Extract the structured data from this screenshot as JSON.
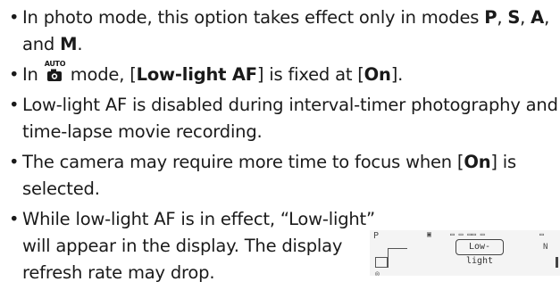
{
  "notes": [
    {
      "segments": [
        {
          "t": "In photo mode, this option takes effect only in modes "
        },
        {
          "t": "P",
          "b": true
        },
        {
          "t": ", "
        },
        {
          "t": "S",
          "b": true
        },
        {
          "t": ", "
        },
        {
          "t": "A",
          "b": true
        },
        {
          "t": ", and "
        },
        {
          "t": "M",
          "b": true
        },
        {
          "t": "."
        }
      ]
    },
    {
      "segments": [
        {
          "t": "In "
        },
        {
          "icon": "auto-mode-camera-icon",
          "label": "AUTO"
        },
        {
          "t": " mode, ["
        },
        {
          "t": "Low-light AF",
          "b": true
        },
        {
          "t": "] is fixed at ["
        },
        {
          "t": "On",
          "b": true
        },
        {
          "t": "]."
        }
      ]
    },
    {
      "segments": [
        {
          "t": "Low-light AF is disabled during interval-timer photography and time-lapse movie recording."
        }
      ]
    },
    {
      "segments": [
        {
          "t": "The camera may require more time to focus when ["
        },
        {
          "t": "On",
          "b": true
        },
        {
          "t": "] is selected."
        }
      ]
    },
    {
      "narrow": true,
      "segments": [
        {
          "t": "While low-light AF is in effect, “Low-light” will appear in the display. The display refresh rate may drop."
        }
      ]
    }
  ],
  "lcd_preview": {
    "mode_letter": "P",
    "indicator_label": "Low-light",
    "right_text": "N",
    "icon_name": "camera-display-preview"
  }
}
